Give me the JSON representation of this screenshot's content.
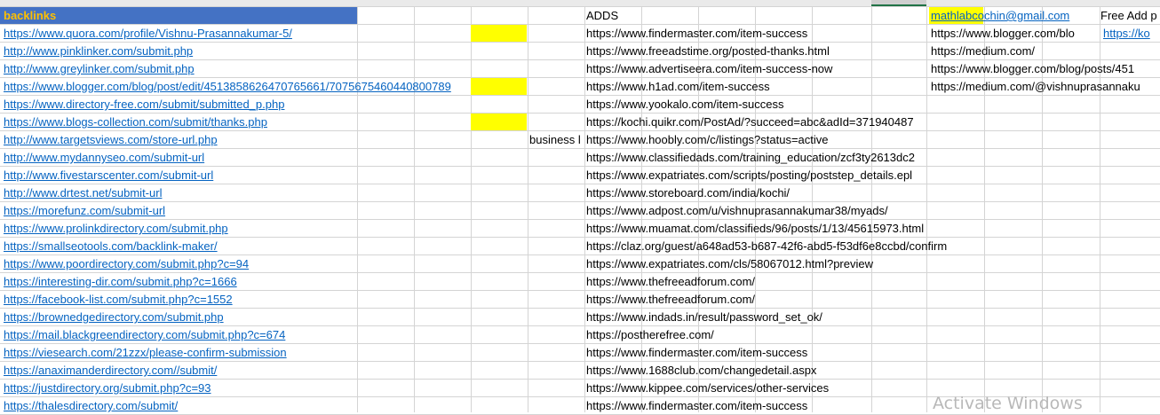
{
  "header": {
    "title": "backlinks",
    "adds_label": "ADDS",
    "email": "mathlabcochin@gmail.com",
    "free_add": "Free Add p"
  },
  "colA": [
    "https://www.quora.com/profile/Vishnu-Prasannakumar-5/",
    "http://www.pinklinker.com/submit.php",
    "http://www.greylinker.com/submit.php",
    "https://www.blogger.com/blog/post/edit/4513858626470765661/7075675460440800789",
    "https://www.directory-free.com/submit/submitted_p.php",
    "https://www.blogs-collection.com/submit/thanks.php",
    "http://www.targetsviews.com/store-url.php",
    "http://www.mydannyseo.com/submit-url",
    "http://www.fivestarscenter.com/submit-url",
    "http://www.drtest.net/submit-url",
    "https://morefunz.com/submit-url",
    "https://www.prolinkdirectory.com/submit.php",
    "https://smallseotools.com/backlink-maker/",
    "https://www.poordirectory.com/submit.php?c=94",
    "https://interesting-dir.com/submit.php?c=1666",
    "https://facebook-list.com/submit.php?c=1552",
    "https://brownedgedirectory.com/submit.php",
    "https://mail.blackgreendirectory.com/submit.php?c=674",
    "https://viesearch.com/21zzx/please-confirm-submission",
    "https://anaximanderdirectory.com//submit/",
    "https://justdirectory.org/submit.php?c=93",
    "https://thalesdirectory.com/submit/"
  ],
  "colI": [
    "https://www.findermaster.com/item-success",
    "https://www.freeadstime.org/posted-thanks.html",
    "https://www.advertiseera.com/item-success-now",
    "https://www.h1ad.com/item-success",
    "https://www.yookalo.com/item-success",
    "https://kochi.quikr.com/PostAd/?succeed=abc&adId=371940487",
    "https://www.hoobly.com/c/listings?status=active",
    "https://www.classifiedads.com/training_education/zcf3ty2613dc2",
    "https://www.expatriates.com/scripts/posting/poststep_details.epl",
    "https://www.storeboard.com/india/kochi/",
    "https://www.adpost.com/u/vishnuprasannakumar38/myads/",
    "https://www.muamat.com/classifieds/96/posts/1/13/45615973.html",
    "https://claz.org/guest/a648ad53-b687-42f6-abd5-f53df6e8ccbd/confirm",
    "https://www.expatriates.com/cls/58067012.html?preview",
    "https://www.thefreeadforum.com/",
    "https://www.thefreeadforum.com/",
    "https://www.indads.in/result/password_set_ok/",
    "https://postherefree.com/",
    "https://www.findermaster.com/item-success",
    "https://www.1688club.com/changedetail.aspx",
    "https://www.kippee.com/services/other-services",
    "https://www.findermaster.com/item-success"
  ],
  "colL": [
    "https://www.blogger.com/blo",
    "https://medium.com/",
    "https://www.blogger.com/blog/posts/451",
    "https://medium.com/@vishnuprasannaku"
  ],
  "colM_row2": "https://ko",
  "colH_row8": "business l",
  "watermark": "Activate Windows"
}
